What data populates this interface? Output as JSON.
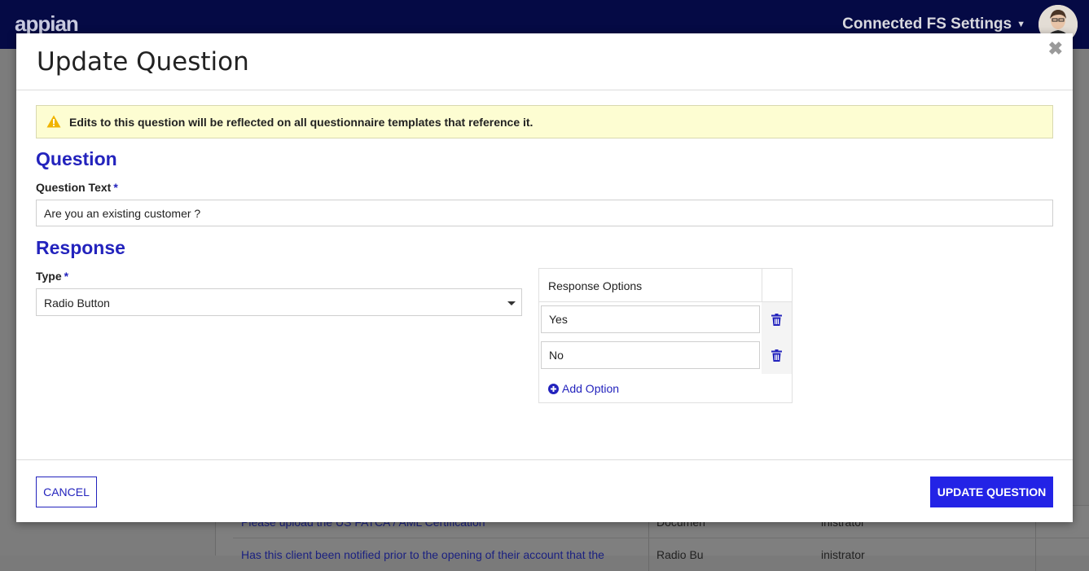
{
  "app": {
    "logo_text": "appian",
    "settings_menu_label": "Connected FS Settings"
  },
  "background_table": {
    "rows": [
      {
        "question": "Please upload the US FATCA / AML Certification",
        "type": "Documen",
        "owner": "inistrator"
      },
      {
        "question": "Has this client been notified prior to the opening of their account that the",
        "type": "Radio Bu",
        "owner": "inistrator"
      }
    ]
  },
  "modal": {
    "title": "Update Question",
    "close_icon": "close-icon",
    "warning_text": "Edits to this question will be reflected on all questionnaire templates that reference it.",
    "question_section_title": "Question",
    "question_text_label": "Question Text",
    "required_marker": "*",
    "question_text_value": "Are you an existing customer ?",
    "response_section_title": "Response",
    "type_label": "Type",
    "type_value": "Radio Button",
    "response_options_header": "Response Options",
    "options": [
      {
        "value": "Yes"
      },
      {
        "value": "No"
      }
    ],
    "add_option_label": "Add Option",
    "cancel_label": "CANCEL",
    "update_label": "UPDATE QUESTION"
  },
  "colors": {
    "accent": "#2323bd",
    "primary_button": "#2323e6",
    "warning_bg": "#fdfdd2",
    "warning_icon": "#f0b400",
    "topbar": "#050a45"
  }
}
